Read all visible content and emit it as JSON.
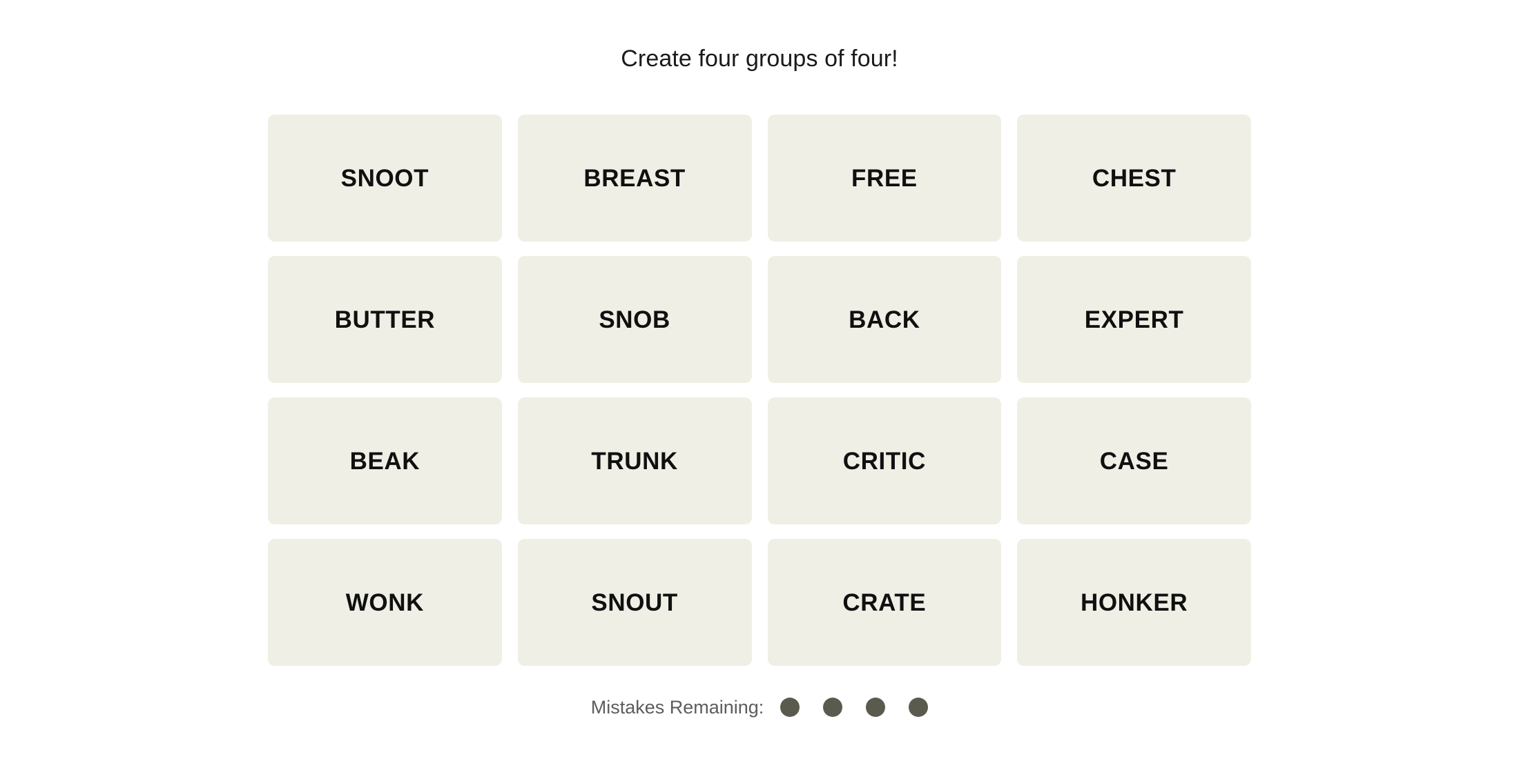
{
  "header": {
    "instruction": "Create four groups of four!"
  },
  "grid": {
    "rows": [
      [
        {
          "word": "SNOOT"
        },
        {
          "word": "BREAST"
        },
        {
          "word": "FREE"
        },
        {
          "word": "CHEST"
        }
      ],
      [
        {
          "word": "BUTTER"
        },
        {
          "word": "SNOB"
        },
        {
          "word": "BACK"
        },
        {
          "word": "EXPERT"
        }
      ],
      [
        {
          "word": "BEAK"
        },
        {
          "word": "TRUNK"
        },
        {
          "word": "CRITIC"
        },
        {
          "word": "CASE"
        }
      ],
      [
        {
          "word": "WONK"
        },
        {
          "word": "SNOUT"
        },
        {
          "word": "CRATE"
        },
        {
          "word": "HONKER"
        }
      ]
    ]
  },
  "footer": {
    "mistakes_label": "Mistakes Remaining:",
    "mistakes_remaining": 4,
    "dots": [
      1,
      2,
      3,
      4
    ]
  },
  "colors": {
    "page_background": "#FFFFFF",
    "tile_background": "#EFEFE6",
    "tile_text": "#101010",
    "title_text": "#1A1A1A",
    "mistakes_text": "#5C5C5C",
    "dot_fill": "#5A5A4E"
  }
}
